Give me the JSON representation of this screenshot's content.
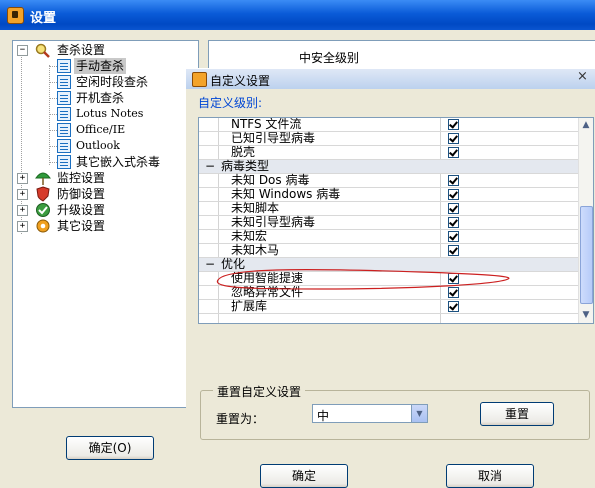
{
  "window": {
    "title": "设置"
  },
  "tree": {
    "root": "查杀设置",
    "children": [
      "手动查杀",
      "空闲时段查杀",
      "开机查杀",
      "Lotus Notes",
      "Office/IE",
      "Outlook",
      "其它嵌入式杀毒"
    ],
    "others": [
      "监控设置",
      "防御设置",
      "升级设置",
      "其它设置"
    ]
  },
  "background_panel": {
    "level_text": "中安全级别"
  },
  "ok_main": "确定(O)",
  "dialog": {
    "title": "自定义设置",
    "level_label": "自定义级别:",
    "rows": [
      {
        "type": "item",
        "name": "NTFS 文件流",
        "checked": true
      },
      {
        "type": "item",
        "name": "已知引导型病毒",
        "checked": true
      },
      {
        "type": "item",
        "name": "脱壳",
        "checked": true
      },
      {
        "type": "group",
        "name": "病毒类型"
      },
      {
        "type": "item",
        "name": "未知 Dos 病毒",
        "checked": true
      },
      {
        "type": "item",
        "name": "未知 Windows 病毒",
        "checked": true
      },
      {
        "type": "item",
        "name": "未知脚本",
        "checked": true
      },
      {
        "type": "item",
        "name": "未知引导型病毒",
        "checked": true
      },
      {
        "type": "item",
        "name": "未知宏",
        "checked": true
      },
      {
        "type": "item",
        "name": "未知木马",
        "checked": true
      },
      {
        "type": "group",
        "name": "优化"
      },
      {
        "type": "item",
        "name": "使用智能提速",
        "checked": true
      },
      {
        "type": "item",
        "name": "忽略异常文件",
        "checked": true
      },
      {
        "type": "item",
        "name": "扩展库",
        "checked": true
      }
    ],
    "reset_group": {
      "legend": "重置自定义设置",
      "label": "重置为：",
      "combo_value": "中",
      "reset_button": "重置"
    },
    "ok_button": "确定",
    "cancel_button": "取消"
  }
}
